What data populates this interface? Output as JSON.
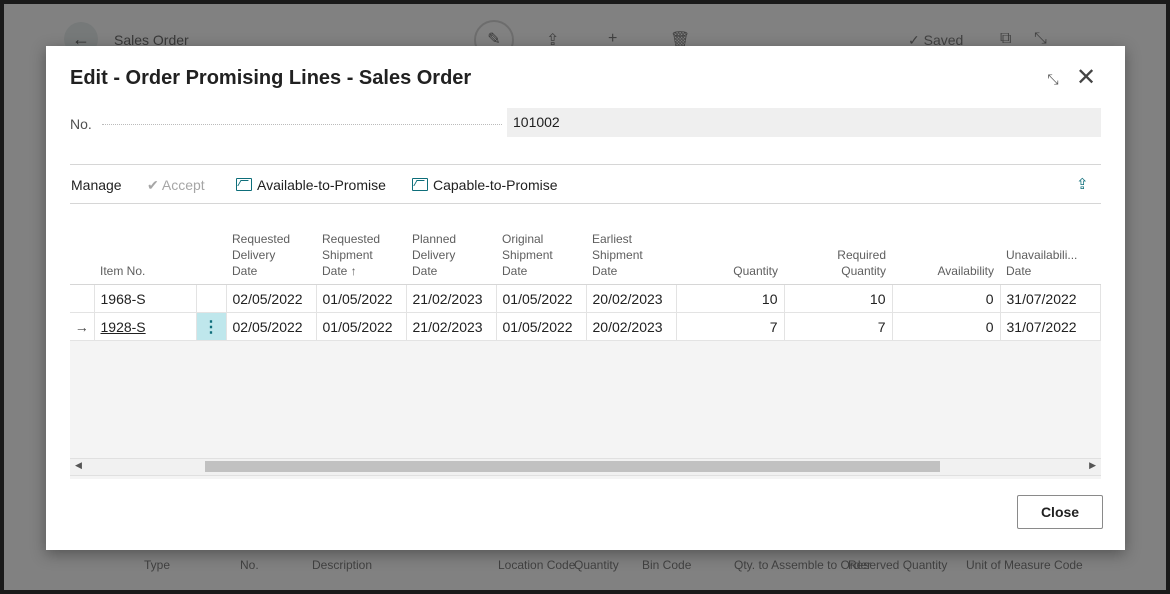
{
  "background": {
    "title": "Sales Order",
    "saved_label": "Saved",
    "grid_columns": [
      "Type",
      "No.",
      "Description",
      "Location Code",
      "Quantity",
      "Bin Code",
      "Qty. to Assemble to Order",
      "Reserved Quantity",
      "Unit of Measure Code"
    ]
  },
  "dialog": {
    "title": "Edit - Order Promising Lines - Sales Order",
    "no_label": "No.",
    "no_value": "101002",
    "actions": {
      "manage": "Manage",
      "accept": "Accept",
      "atp": "Available-to-Promise",
      "ctp": "Capable-to-Promise"
    },
    "columns": {
      "item_no": "Item No.",
      "req_delivery": [
        "Requested",
        "Delivery",
        "Date"
      ],
      "req_shipment": [
        "Requested",
        "Shipment",
        "Date ↑"
      ],
      "planned_delivery": [
        "Planned",
        "Delivery",
        "Date"
      ],
      "original_shipment": [
        "Original",
        "Shipment",
        "Date"
      ],
      "earliest_shipment": [
        "Earliest",
        "Shipment",
        "Date"
      ],
      "quantity": "Quantity",
      "required_quantity": [
        "Required",
        "Quantity"
      ],
      "availability": "Availability",
      "unavailability": [
        "Unavailabili...",
        "Date"
      ]
    },
    "rows": [
      {
        "item_no": "1968-S",
        "req_delivery": "02/05/2022",
        "req_shipment": "01/05/2022",
        "planned_delivery": "21/02/2023",
        "original_shipment": "01/05/2022",
        "earliest_shipment": "20/02/2023",
        "quantity": "10",
        "required_quantity": "10",
        "availability": "0",
        "unavailability": "31/07/2022"
      },
      {
        "item_no": "1928-S",
        "req_delivery": "02/05/2022",
        "req_shipment": "01/05/2022",
        "planned_delivery": "21/02/2023",
        "original_shipment": "01/05/2022",
        "earliest_shipment": "20/02/2023",
        "quantity": "7",
        "required_quantity": "7",
        "availability": "0",
        "unavailability": "31/07/2022"
      }
    ],
    "close_label": "Close"
  },
  "colors": {
    "accent": "#0e6e7a",
    "selected_cell": "#bfe7ec"
  }
}
